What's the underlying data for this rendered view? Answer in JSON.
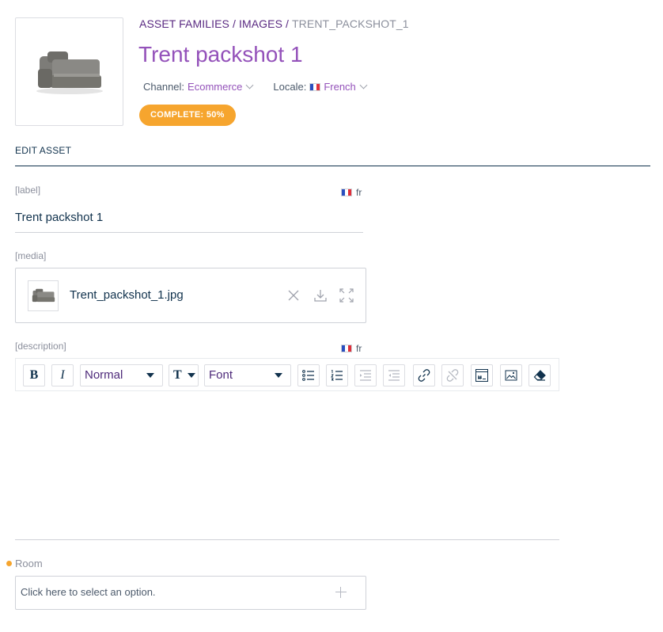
{
  "header": {
    "breadcrumb": {
      "families": "ASSET FAMILIES",
      "family": "IMAGES",
      "current": "TRENT_PACKSHOT_1",
      "separator": "/"
    },
    "title": "Trent packshot 1",
    "channel": {
      "label": "Channel:",
      "value": "Ecommerce"
    },
    "locale": {
      "label": "Locale:",
      "value": "French"
    },
    "completeness": "COMPLETE: 50%"
  },
  "section": {
    "title": "EDIT ASSET"
  },
  "fields": {
    "label": {
      "label": "[label]",
      "locale": "fr",
      "value": "Trent packshot 1"
    },
    "media": {
      "label": "[media]",
      "filename": "Trent_packshot_1.jpg"
    },
    "description": {
      "label": "[description]",
      "locale": "fr"
    },
    "room": {
      "label": "Room",
      "placeholder": "Click here to select an option."
    }
  },
  "toolbar": {
    "bold": "B",
    "italic": "I",
    "block_type": "Normal",
    "font": "Font",
    "font_size_icon": "T"
  },
  "colors": {
    "accent": "#9452ba",
    "badge": "#f6a52e",
    "text": "#11324d",
    "muted": "#8b8f9c"
  }
}
